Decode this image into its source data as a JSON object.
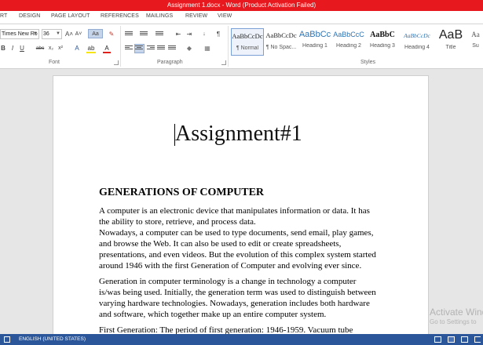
{
  "window": {
    "title": "Assignment 1.docx - Word (Product Activation Failed)"
  },
  "ribbon_tabs": [
    "RT",
    "DESIGN",
    "PAGE LAYOUT",
    "REFERENCES",
    "MAILINGS",
    "REVIEW",
    "VIEW"
  ],
  "font": {
    "name": "Times New Ro",
    "size": "36",
    "grow": "A˄",
    "shrink": "A˅",
    "case": "Aa",
    "bold": "B",
    "italic": "I",
    "underline": "U",
    "strike": "abc",
    "subscript": "x₂",
    "superscript": "x²",
    "group_label": "Font"
  },
  "paragraph": {
    "group_label": "Paragraph",
    "pilcrow": "¶"
  },
  "styles": {
    "group_label": "Styles",
    "items": [
      {
        "sample": "AaBbCcDc",
        "name": "¶ Normal"
      },
      {
        "sample": "AaBbCcDc",
        "name": "¶ No Spac..."
      },
      {
        "sample": "AaBbCc",
        "name": "Heading 1"
      },
      {
        "sample": "AaBbCcC",
        "name": "Heading 2"
      },
      {
        "sample": "AaBbC",
        "name": "Heading 3"
      },
      {
        "sample": "AaBbCcDc",
        "name": "Heading 4"
      },
      {
        "sample": "AaB",
        "name": "Title"
      },
      {
        "sample": "Aa",
        "name": "Su"
      }
    ]
  },
  "document": {
    "title": "Assignment#1",
    "heading": "GENERATIONS OF COMPUTER",
    "lines": [
      "A computer is an electronic device that manipulates information or data. It has",
      "the ability to store, retrieve, and process data.",
      "Nowadays, a computer can be used to type documents, send email, play games,",
      "and browse the Web. It can also be used to edit or create spreadsheets,",
      "presentations, and even videos. But the evolution of this complex system started",
      "around 1946 with the first Generation of Computer and evolving ever since.",
      "Generation in computer terminology is a change in technology a computer",
      "is/was being used. Initially, the generation term was used to distinguish between",
      "varying hardware technologies. Nowadays, generation includes both hardware",
      "and software, which together make up an entire computer system.",
      "First Generation: The period of first generation: 1946-1959. Vacuum tube"
    ]
  },
  "watermark": {
    "line1": "Activate Wind",
    "line2": "Go to Settings to"
  },
  "statusbar": {
    "language": "ENGLISH (UNITED STATES)"
  }
}
